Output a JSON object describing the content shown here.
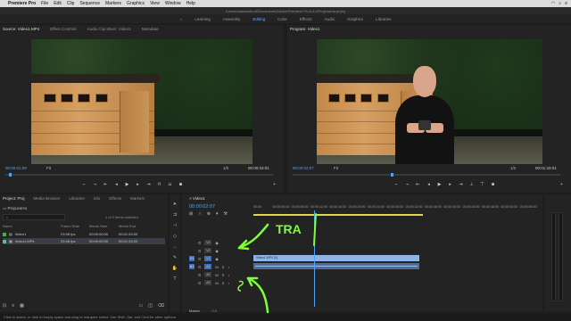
{
  "menubar": {
    "app_name": "Premiere Pro",
    "items": [
      "File",
      "Edit",
      "Clip",
      "Sequence",
      "Markers",
      "Graphics",
      "View",
      "Window",
      "Help"
    ]
  },
  "titlebar": {
    "path": "/Users/adamcallcott/Documents/Adobe/Premiere Pro/13.0/ProjLearns.prproj"
  },
  "workspaces": {
    "items": [
      "Learning",
      "Assembly",
      "Editing",
      "Color",
      "Effects",
      "Audio",
      "Graphics",
      "Libraries"
    ],
    "active": "Editing"
  },
  "source": {
    "tabs": [
      "Source: Video1.MP4",
      "Effect Controls",
      "Audio Clip Mixer: Video1",
      "Metadata"
    ],
    "timecode": "00:00:01:09",
    "fit": "Fit",
    "resolution": "1/2",
    "duration": "00:00:33:01"
  },
  "program": {
    "tab": "Program: Video1",
    "timecode": "00:00:02:07",
    "fit": "Fit",
    "resolution": "1/2",
    "duration": "00:01:33:01"
  },
  "project": {
    "tabs": [
      "Project: Proj",
      "Media Browser",
      "Libraries",
      "Info",
      "Effects",
      "Markers"
    ],
    "name": "ProjLearns",
    "search_placeholder": "",
    "item_count": "1 of 2 items selected",
    "columns": [
      "Name",
      "Frame Rate",
      "Media Start",
      "Media End"
    ],
    "items": [
      {
        "name": "Video1",
        "rate": "23.98 fps",
        "start": "00:00:00:00",
        "end": "00:01:33:00",
        "color": "#4bb04b"
      },
      {
        "name": "Video1.MP4",
        "rate": "23.98 fps",
        "start": "00:00:00:00",
        "end": "00:01:33:00",
        "color": "#5dbaa0"
      }
    ]
  },
  "timeline": {
    "tab": "Video1",
    "timecode": "00:00:02:07",
    "ruler": [
      "00:00",
      "00:00:04:00",
      "00:00:08:00",
      "00:00:12:00",
      "00:00:16:00",
      "00:00:20:00",
      "00:00:24:00",
      "00:00:28:00",
      "00:00:32:00",
      "00:00:36:00",
      "00:00:40:00",
      "00:00:44:00",
      "00:00:48:00",
      "00:00:52:00",
      "00:00:56:00"
    ],
    "tracks": [
      {
        "target": "",
        "label": "V3"
      },
      {
        "target": "",
        "label": "V2"
      },
      {
        "target": "V1",
        "label": "V1"
      },
      {
        "target": "A1",
        "label": "A1"
      },
      {
        "target": "",
        "label": "A2"
      },
      {
        "target": "",
        "label": "A3"
      }
    ],
    "clip_name": "Video1.MP4 [V]",
    "master_label": "Master",
    "master_value": "0.0"
  },
  "status_bar": "Click to select, or click in empty space and drag to marquee select. Use Shift, Opt, and Cmd for other options.",
  "annotations": {
    "label": "TRA"
  },
  "colors": {
    "accent": "#4ea3ff",
    "annotation": "#7dff3a",
    "workarea": "#e2d64c"
  }
}
